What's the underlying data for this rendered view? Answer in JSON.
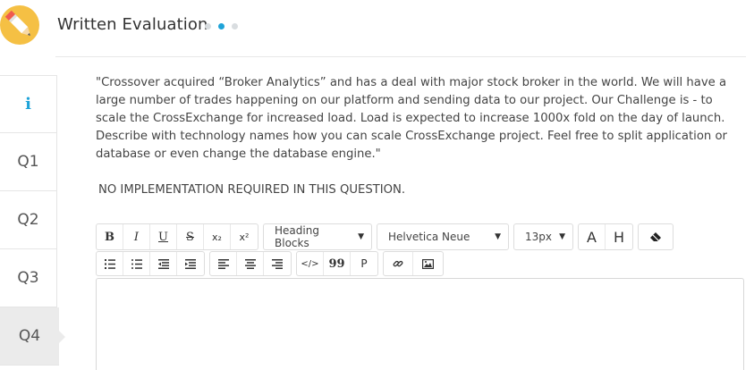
{
  "header": {
    "title": "Written Evaluation",
    "steps": 3,
    "active_step": 2
  },
  "sidebar": {
    "items": [
      {
        "label": "i"
      },
      {
        "label": "Q1"
      },
      {
        "label": "Q2"
      },
      {
        "label": "Q3"
      },
      {
        "label": "Q4"
      }
    ],
    "active_index": 4
  },
  "question": {
    "text": "\"Crossover acquired “Broker Analytics” and has a deal with major stock broker in the world. We will have a large number of trades happening on our platform and sending data to our project. Our Challenge is - to scale the CrossExchange for increased load. Load is expected to increase 1000x fold on the day of launch. Describe with technology names how you can scale CrossExchange project. Feel free to split application or database or even change the database engine.\"",
    "note": "NO IMPLEMENTATION REQUIRED IN THIS QUESTION."
  },
  "toolbar": {
    "bold": "B",
    "italic": "I",
    "underline": "U",
    "strike": "S",
    "subscript": "x₂",
    "superscript": "x²",
    "heading_select": "Heading Blocks",
    "font_select": "Helvetica Neue",
    "size_select": "13px",
    "font_color": "A",
    "highlight": "H",
    "blockquote": "99",
    "paragraph": "P",
    "code": "</>"
  },
  "colors": {
    "accent": "#1ea3d8",
    "logo": "#f5c044",
    "active_tab": "#ebebeb"
  }
}
